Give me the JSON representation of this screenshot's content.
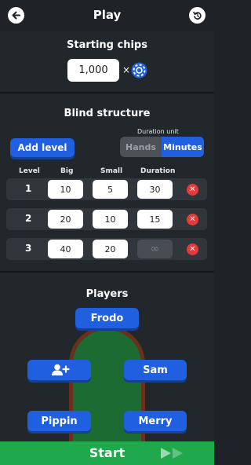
{
  "header": {
    "title": "Play",
    "back_icon": "back-arrow-icon",
    "reset_icon": "reset-icon"
  },
  "starting_chips": {
    "title": "Starting chips",
    "value": "1,000",
    "times": "×",
    "chip_icon": "poker-chip-icon"
  },
  "blind_structure": {
    "title": "Blind structure",
    "add_level_label": "Add level",
    "duration_unit_label": "Duration unit",
    "units": {
      "hands": "Hands",
      "minutes": "Minutes",
      "selected": "Minutes"
    },
    "columns": {
      "level": "Level",
      "big": "Big",
      "small": "Small",
      "duration": "Duration"
    },
    "rows": [
      {
        "level": "1",
        "big": "10",
        "small": "5",
        "duration": "30"
      },
      {
        "level": "2",
        "big": "20",
        "small": "10",
        "duration": "15"
      },
      {
        "level": "3",
        "big": "40",
        "small": "20",
        "duration": "∞"
      }
    ]
  },
  "players": {
    "title": "Players",
    "seats": {
      "top": "Frodo",
      "right_upper": "Sam",
      "left_lower": "Pippin",
      "right_lower": "Merry"
    },
    "add_player_icon": "add-player-icon"
  },
  "start": {
    "label": "Start",
    "icon": "fast-forward-icon"
  },
  "colors": {
    "accent": "#1f5fe0",
    "start": "#1fa84c",
    "delete": "#e23b3b",
    "background": "#1f2327"
  }
}
